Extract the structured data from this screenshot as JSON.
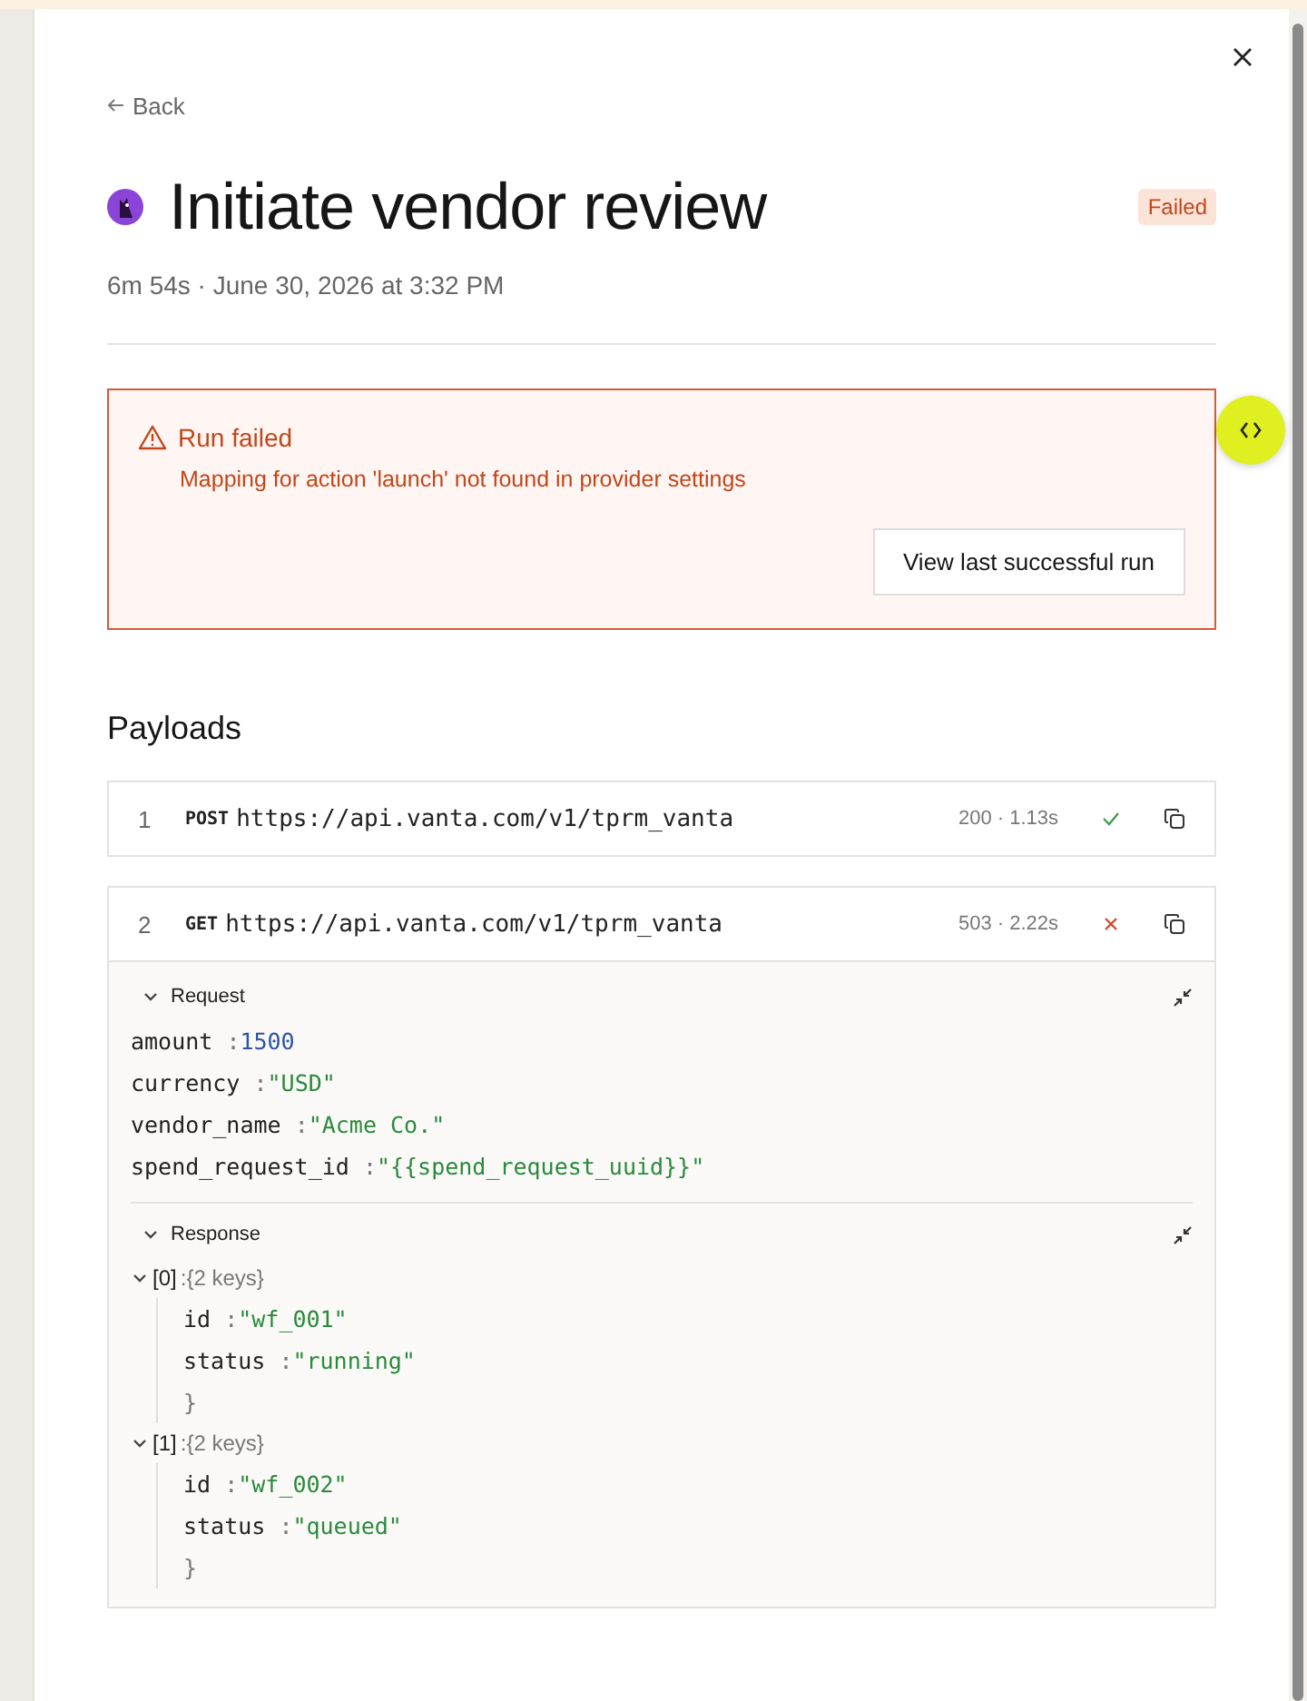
{
  "back_link": "Back",
  "title": "Initiate vendor review",
  "status_badge": {
    "label": "Failed",
    "kind": "failed"
  },
  "meta": "6m 54s · June 30, 2026 at 3:32 PM",
  "alert": {
    "title": "Run failed",
    "message": "Mapping for action 'launch' not found in provider settings",
    "button": "View last successful run"
  },
  "payloads": {
    "heading": "Payloads",
    "separator": ":",
    "items": [
      {
        "index": "1",
        "method": "POST",
        "url": "https://api.vanta.com/v1/tprm_vanta",
        "status": "200 · 1.13s",
        "ok": true,
        "expanded": false
      },
      {
        "index": "2",
        "method": "GET",
        "url": "https://api.vanta.com/v1/tprm_vanta",
        "status": "503 · 2.22s",
        "ok": false,
        "expanded": true,
        "request": {
          "label": "Request",
          "expanded": true,
          "fields": [
            {
              "key": "amount",
              "value": "1500",
              "kind": "number"
            },
            {
              "key": "currency",
              "value": "\"USD\"",
              "kind": "string"
            },
            {
              "key": "vendor_name",
              "value": "\"Acme Co.\"",
              "kind": "string"
            },
            {
              "key": "spend_request_id",
              "value": "\"{{spend_request_uuid}}\"",
              "kind": "string"
            }
          ]
        },
        "response": {
          "label": "Response",
          "expanded": true,
          "entries": [
            {
              "label": "[0]",
              "summary": "{2 keys}",
              "expanded": true,
              "closing": "}",
              "fields": [
                {
                  "key": "id",
                  "value": "\"wf_001\"",
                  "kind": "string"
                },
                {
                  "key": "status",
                  "value": "\"running\"",
                  "kind": "string"
                }
              ]
            },
            {
              "label": "[1]",
              "summary": "{2 keys}",
              "expanded": true,
              "closing": "}",
              "fields": [
                {
                  "key": "id",
                  "value": "\"wf_002\"",
                  "kind": "string"
                },
                {
                  "key": "status",
                  "value": "\"queued\"",
                  "kind": "string"
                }
              ]
            }
          ]
        }
      }
    ]
  }
}
